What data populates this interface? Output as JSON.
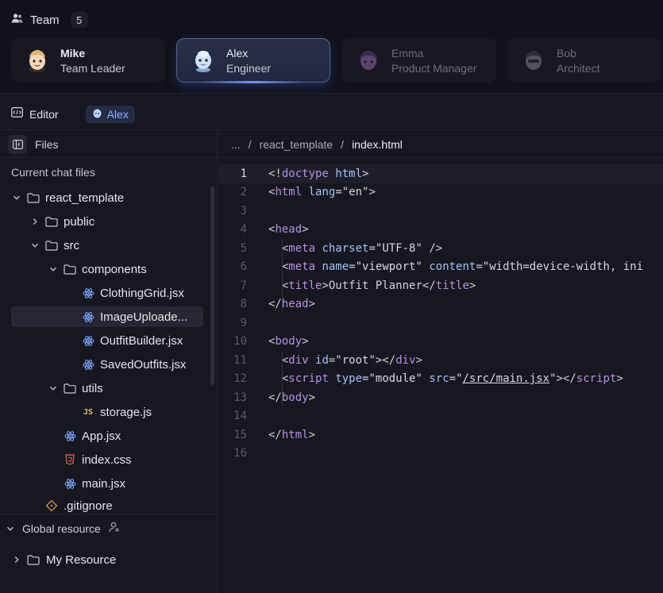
{
  "team": {
    "title": "Team",
    "count": "5",
    "members": [
      {
        "name": "Mike",
        "role": "Team Leader",
        "avatar": "mike-avatar"
      },
      {
        "name": "Alex",
        "role": "Engineer",
        "avatar": "alex-avatar"
      },
      {
        "name": "Emma",
        "role": "Product Manager",
        "avatar": "emma-avatar"
      },
      {
        "name": "Bob",
        "role": "Architect",
        "avatar": "bob-avatar"
      }
    ]
  },
  "editor": {
    "label": "Editor",
    "active_agent": "Alex"
  },
  "files": {
    "header": "Files",
    "section_label": "Current chat files",
    "tree": [
      {
        "label": "react_template",
        "type": "folder",
        "expanded": true
      },
      {
        "label": "public",
        "type": "folder",
        "expanded": false
      },
      {
        "label": "src",
        "type": "folder",
        "expanded": true
      },
      {
        "label": "components",
        "type": "folder",
        "expanded": true
      },
      {
        "label": "ClothingGrid.jsx",
        "type": "jsx"
      },
      {
        "label": "ImageUploade...",
        "type": "jsx",
        "selected": true
      },
      {
        "label": "OutfitBuilder.jsx",
        "type": "jsx"
      },
      {
        "label": "SavedOutfits.jsx",
        "type": "jsx"
      },
      {
        "label": "utils",
        "type": "folder",
        "expanded": true
      },
      {
        "label": "storage.js",
        "type": "js"
      },
      {
        "label": "App.jsx",
        "type": "jsx"
      },
      {
        "label": "index.css",
        "type": "css"
      },
      {
        "label": "main.jsx",
        "type": "jsx"
      },
      {
        "label": ".gitignore",
        "type": "git"
      }
    ],
    "global_resource": "Global resource",
    "my_resource": "My Resource"
  },
  "breadcrumb": {
    "ellipsis": "...",
    "sep1": "/",
    "folder": "react_template",
    "sep2": "/",
    "file": "index.html"
  },
  "code": {
    "current_line": 1,
    "lines": [
      {
        "n": "1",
        "tokens": [
          [
            "p",
            "<!"
          ],
          [
            "t",
            "doctype"
          ],
          [
            "p",
            " "
          ],
          [
            "a",
            "html"
          ],
          [
            "p",
            ">"
          ]
        ]
      },
      {
        "n": "2",
        "tokens": [
          [
            "p",
            "<"
          ],
          [
            "t",
            "html"
          ],
          [
            "p",
            " "
          ],
          [
            "a",
            "lang"
          ],
          [
            "p",
            "="
          ],
          [
            "s",
            "\"en\""
          ],
          [
            "p",
            ">"
          ]
        ]
      },
      {
        "n": "3",
        "tokens": []
      },
      {
        "n": "4",
        "tokens": [
          [
            "p",
            "<"
          ],
          [
            "t",
            "head"
          ],
          [
            "p",
            ">"
          ]
        ]
      },
      {
        "n": "5",
        "tokens": [
          [
            "p",
            "  <"
          ],
          [
            "t",
            "meta"
          ],
          [
            "p",
            " "
          ],
          [
            "a",
            "charset"
          ],
          [
            "p",
            "="
          ],
          [
            "s",
            "\"UTF-8\""
          ],
          [
            "p",
            " />"
          ]
        ]
      },
      {
        "n": "6",
        "tokens": [
          [
            "p",
            "  <"
          ],
          [
            "t",
            "meta"
          ],
          [
            "p",
            " "
          ],
          [
            "a",
            "name"
          ],
          [
            "p",
            "="
          ],
          [
            "s",
            "\"viewport\""
          ],
          [
            "p",
            " "
          ],
          [
            "a",
            "content"
          ],
          [
            "p",
            "="
          ],
          [
            "s",
            "\"width=device-width, ini"
          ]
        ]
      },
      {
        "n": "7",
        "tokens": [
          [
            "p",
            "  <"
          ],
          [
            "t",
            "title"
          ],
          [
            "p",
            ">Outfit Planner</"
          ],
          [
            "t",
            "title"
          ],
          [
            "p",
            ">"
          ]
        ]
      },
      {
        "n": "8",
        "tokens": [
          [
            "p",
            "</"
          ],
          [
            "t",
            "head"
          ],
          [
            "p",
            ">"
          ]
        ]
      },
      {
        "n": "9",
        "tokens": []
      },
      {
        "n": "10",
        "tokens": [
          [
            "p",
            "<"
          ],
          [
            "t",
            "body"
          ],
          [
            "p",
            ">"
          ]
        ]
      },
      {
        "n": "11",
        "tokens": [
          [
            "p",
            "  <"
          ],
          [
            "t",
            "div"
          ],
          [
            "p",
            " "
          ],
          [
            "a",
            "id"
          ],
          [
            "p",
            "="
          ],
          [
            "s",
            "\"root\""
          ],
          [
            "p",
            "></"
          ],
          [
            "t",
            "div"
          ],
          [
            "p",
            ">"
          ]
        ]
      },
      {
        "n": "12",
        "tokens": [
          [
            "p",
            "  <"
          ],
          [
            "t",
            "script"
          ],
          [
            "p",
            " "
          ],
          [
            "a",
            "type"
          ],
          [
            "p",
            "="
          ],
          [
            "s",
            "\"module\""
          ],
          [
            "p",
            " "
          ],
          [
            "a",
            "src"
          ],
          [
            "p",
            "=\""
          ],
          [
            "l",
            "/src/main.jsx"
          ],
          [
            "p",
            "\"></"
          ],
          [
            "t",
            "script"
          ],
          [
            "p",
            ">"
          ]
        ]
      },
      {
        "n": "13",
        "tokens": [
          [
            "p",
            "</"
          ],
          [
            "t",
            "body"
          ],
          [
            "p",
            ">"
          ]
        ]
      },
      {
        "n": "14",
        "tokens": []
      },
      {
        "n": "15",
        "tokens": [
          [
            "p",
            "</"
          ],
          [
            "t",
            "html"
          ],
          [
            "p",
            ">"
          ]
        ]
      },
      {
        "n": "16",
        "tokens": []
      }
    ]
  },
  "colors": {
    "tag": "#b98de8",
    "attr": "#9fc3ff",
    "accent": "#8fb0ff"
  }
}
